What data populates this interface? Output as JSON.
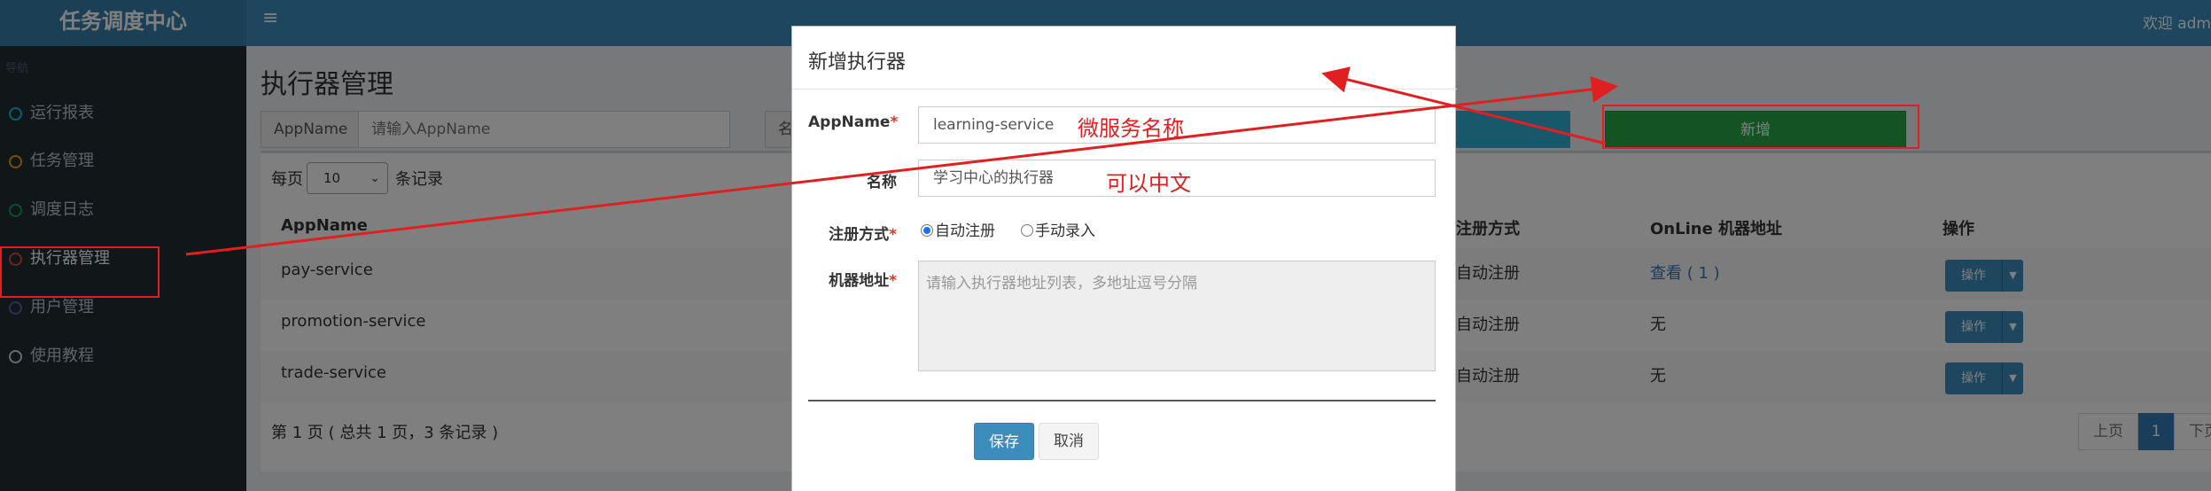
{
  "app": {
    "logo": "任务调度中心",
    "welcome": "欢迎 adm"
  },
  "header": {
    "menu_glyph": "≡"
  },
  "sidebar": {
    "header": "导航",
    "items": [
      {
        "label": "运行报表",
        "color": "#00c0ef"
      },
      {
        "label": "任务管理",
        "color": "#f39c12"
      },
      {
        "label": "调度日志",
        "color": "#00a65a"
      },
      {
        "label": "执行器管理",
        "color": "#dd4b39"
      },
      {
        "label": "用户管理",
        "color": "#605ca8"
      },
      {
        "label": "使用教程",
        "color": "#d2d6de"
      }
    ]
  },
  "main": {
    "title": "执行器管理",
    "search": {
      "label": "AppName",
      "placeholder": "请输入AppName",
      "label2": "名"
    },
    "add_button": "新增",
    "per_page": {
      "prefix": "每页",
      "value": "10",
      "suffix": "条记录"
    },
    "table": {
      "headers": {
        "appname": "AppName",
        "register_type": "注册方式",
        "online": "OnLine 机器地址",
        "ops": "操作"
      },
      "rows": [
        {
          "appname": "pay-service",
          "register_type": "自动注册",
          "online": "查看 ( 1 )",
          "op": "操作"
        },
        {
          "appname": "promotion-service",
          "register_type": "自动注册",
          "online": "无",
          "op": "操作"
        },
        {
          "appname": "trade-service",
          "register_type": "自动注册",
          "online": "无",
          "op": "操作"
        }
      ]
    },
    "pager": {
      "info": "第 1 页 ( 总共 1 页，3 条记录 )",
      "prev": "上页",
      "current": "1",
      "next": "下页"
    }
  },
  "modal": {
    "title": "新增执行器",
    "appname_label": "AppName",
    "appname_value": "learning-service",
    "name_label": "名称",
    "name_value": "学习中心的执行器",
    "register_label": "注册方式",
    "radio_auto": "自动注册",
    "radio_manual": "手动录入",
    "address_label": "机器地址",
    "address_placeholder": "请输入执行器地址列表，多地址逗号分隔",
    "required_mark": "*",
    "save": "保存",
    "cancel": "取消"
  },
  "annotations": {
    "appname_note": "微服务名称",
    "name_note": "可以中文"
  },
  "colors": {
    "annotation": "#e02020",
    "primary": "#3c8dbc",
    "success": "#28a745"
  }
}
